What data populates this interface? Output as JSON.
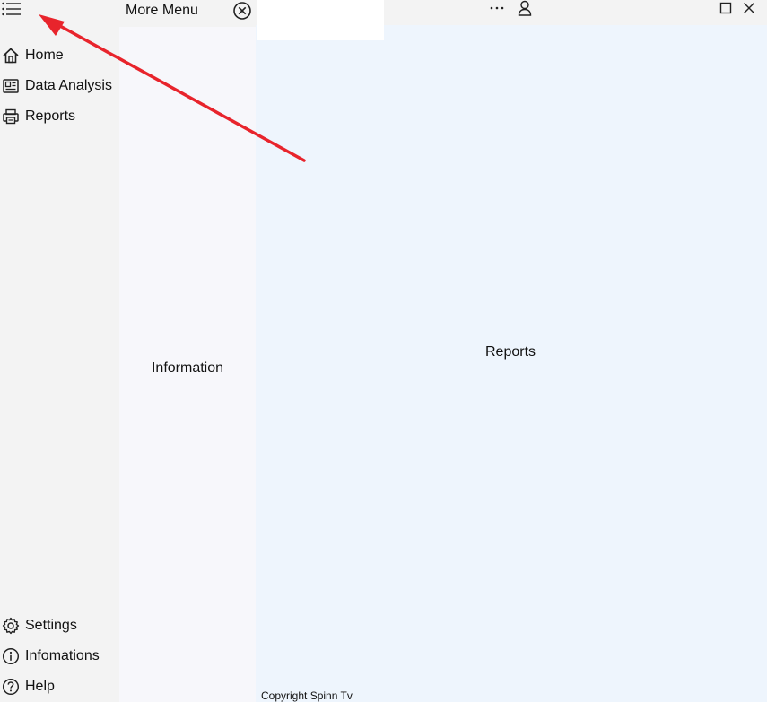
{
  "sidebar": {
    "menu_icon": "hamburger-menu-icon",
    "top_items": [
      {
        "label": "Home",
        "icon": "home-icon"
      },
      {
        "label": "Data Analysis",
        "icon": "data-analysis-icon"
      },
      {
        "label": "Reports",
        "icon": "printer-icon"
      }
    ],
    "bottom_items": [
      {
        "label": "Settings",
        "icon": "gear-icon"
      },
      {
        "label": "Infomations",
        "icon": "info-icon"
      },
      {
        "label": "Help",
        "icon": "help-icon"
      }
    ]
  },
  "more_menu": {
    "title": "More Menu",
    "close_icon": "close-circle-icon",
    "content_label": "Information"
  },
  "titlebar": {
    "more_icon": "more-horizontal-icon",
    "user_icon": "user-icon",
    "maximize_icon": "maximize-icon",
    "close_icon": "close-icon"
  },
  "main": {
    "page_label": "Reports",
    "footer": "Copyright Spinn Tv"
  },
  "annotation": {
    "arrow_color": "#e8242c"
  }
}
